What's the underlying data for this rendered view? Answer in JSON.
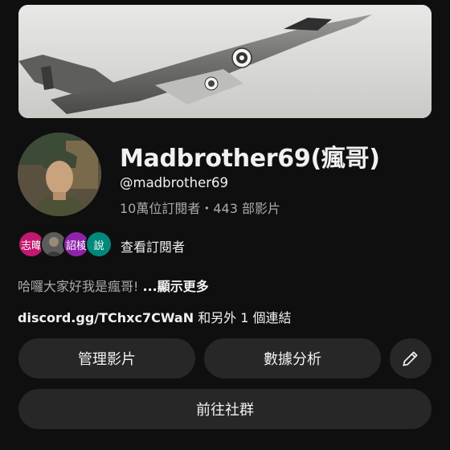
{
  "channel": {
    "name": "Madbrother69(瘋哥)",
    "handle": "@madbrother69",
    "stats": "10萬位訂閱者・443 部影片"
  },
  "subscribers": {
    "chips": [
      "志暐",
      "",
      "詔棱",
      "說"
    ],
    "view_label": "查看訂閱者"
  },
  "description": {
    "text": "哈囉大家好我是瘋哥!",
    "more_label": "...顯示更多"
  },
  "links": {
    "url": "discord.gg/TChxc7CWaN",
    "more_text": " 和另外 1 個連結"
  },
  "actions": {
    "manage_videos": "管理影片",
    "analytics": "數據分析",
    "edit_icon": "pencil-icon",
    "community": "前往社群"
  },
  "colors": {
    "background": "#0f0f0f",
    "button_bg": "#272727",
    "secondary_text": "#aaaaaa",
    "chip1": "#c2186d",
    "chip3": "#8e24aa",
    "chip4": "#00897b"
  }
}
